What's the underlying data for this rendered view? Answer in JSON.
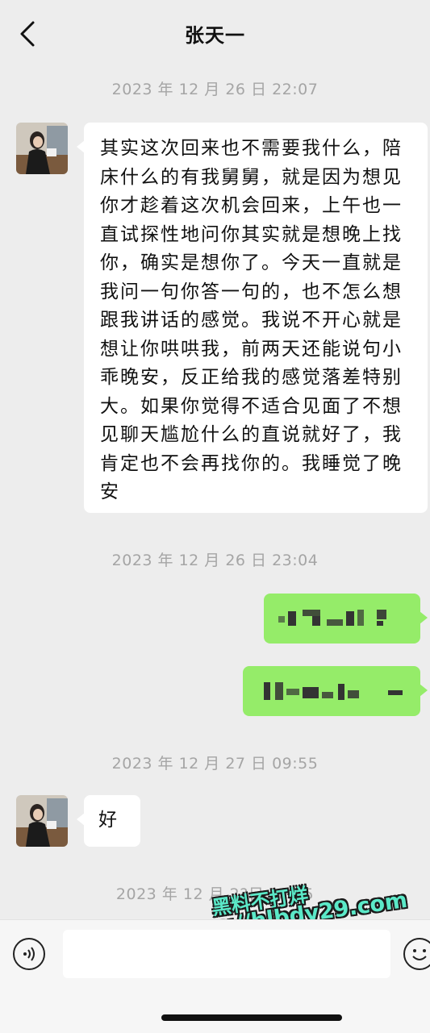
{
  "header": {
    "title": "张天一",
    "back_icon": "chevron-left-icon"
  },
  "messages": [
    {
      "type": "timestamp",
      "text": "2023 年 12 月 26 日 22:07"
    },
    {
      "type": "incoming",
      "text": "其实这次回来也不需要我什么，陪床什么的有我舅舅，就是因为想见你才趁着这次机会回来，上午也一直试探性地问你其实就是想晚上找你，确实是想你了。今天一直就是我问一句你答一句的，也不怎么想跟我讲话的感觉。我说不开心就是想让你哄哄我，前两天还能说句小乖晚安，反正给我的感觉落差特别大。如果你觉得不适合见面了不想见聊天尴尬什么的直说就好了，我肯定也不会再找你的。我睡觉了晚安"
    },
    {
      "type": "timestamp",
      "text": "2023 年 12 月 26 日 23:04"
    },
    {
      "type": "outgoing",
      "text": "",
      "pixelated": true
    },
    {
      "type": "outgoing",
      "text": "",
      "pixelated": true
    },
    {
      "type": "timestamp",
      "text": "2023 年 12 月 27 日 09:55"
    },
    {
      "type": "incoming",
      "text": "好"
    },
    {
      "type": "timestamp",
      "text": "2023 年 12 月 2?日 ?0:45"
    }
  ],
  "watermark": {
    "line1": "黑料不打烊",
    "line2": "https://hlbdy29.com"
  },
  "input_bar": {
    "voice_icon": "voice-icon",
    "emoji_icon": "emoji-icon",
    "input_value": ""
  },
  "colors": {
    "background": "#ededed",
    "incoming_bubble": "#ffffff",
    "outgoing_bubble": "#95ec69",
    "timestamp": "#a5a5a5"
  }
}
